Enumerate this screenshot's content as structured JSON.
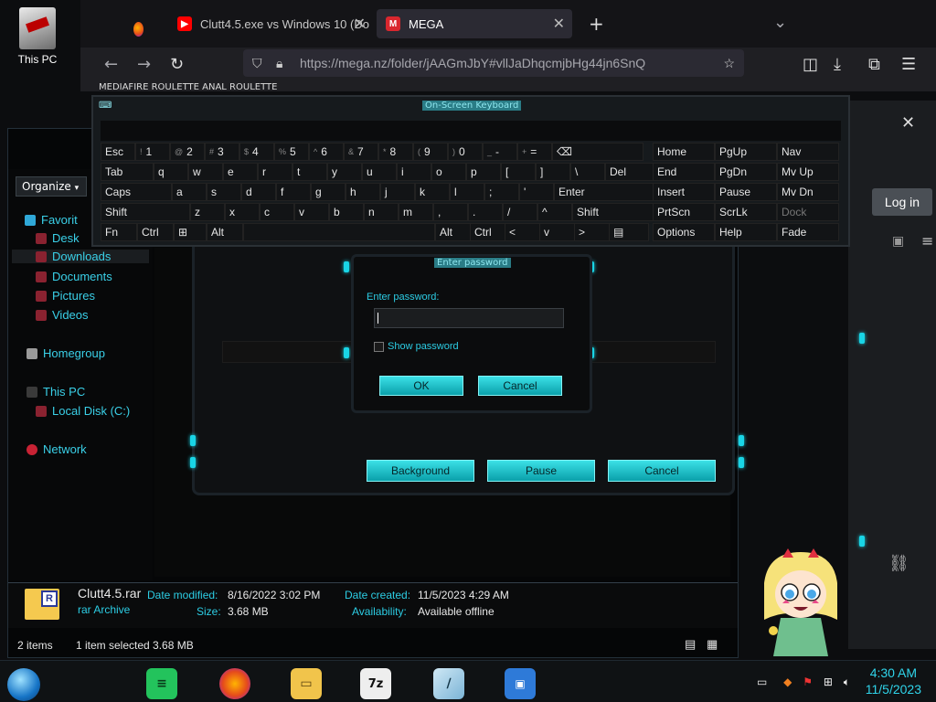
{
  "desktop": {
    "icon_label": "This PC"
  },
  "browser": {
    "tabs": [
      {
        "label": "Clutt4.5.exe vs Windows 10 (Do",
        "icon": "youtube-icon"
      },
      {
        "label": "MEGA",
        "icon": "mega-icon"
      }
    ],
    "url": "https://mega.nz/folder/jAAGmJbY#vllJaDhqcmjbHg44jn6SnQ",
    "bookmarks": "MEDIAFIRE ROULETTE     ANAL ROULETTE"
  },
  "explorer": {
    "organize": "Organize",
    "tree": {
      "favorites": "Favorit",
      "desktop": "Desk",
      "downloads": "Downloads",
      "documents": "Documents",
      "pictures": "Pictures",
      "videos": "Videos",
      "homegroup": "Homegroup",
      "this_pc": "This PC",
      "local_disk": "Local Disk (C:)",
      "network": "Network"
    },
    "details": {
      "file_name": "Clutt4.5.rar",
      "file_type": "rar Archive",
      "date_modified_label": "Date modified:",
      "date_modified": "8/16/2022 3:02 PM",
      "size_label": "Size:",
      "size": "3.68 MB",
      "date_created_label": "Date created:",
      "date_created": "11/5/2023 4:29 AM",
      "availability_label": "Availability:",
      "availability": "Available offline"
    },
    "status": {
      "items": "2 items",
      "selected": "1 item selected  3.68 MB"
    }
  },
  "mega": {
    "login": "Log in"
  },
  "progress_dialog": {
    "background": "Background",
    "pause": "Pause",
    "cancel": "Cancel"
  },
  "password_dialog": {
    "title": "Enter password",
    "label": "Enter password:",
    "value": "",
    "show_password": "Show password",
    "ok": "OK",
    "cancel": "Cancel"
  },
  "keyboard": {
    "title": "On-Screen Keyboard",
    "rows": {
      "r1": [
        "Esc",
        "1",
        "2",
        "3",
        "4",
        "5",
        "6",
        "7",
        "8",
        "9",
        "0",
        "-",
        "="
      ],
      "r1_sub": [
        "~ `",
        "!",
        "@",
        "#",
        "$",
        "%",
        "^",
        "&",
        "*",
        "(",
        ")",
        "_",
        "+"
      ],
      "r2": [
        "Tab",
        "q",
        "w",
        "e",
        "r",
        "t",
        "y",
        "u",
        "i",
        "o",
        "p",
        "[",
        "]",
        "\\",
        "Del"
      ],
      "r3": [
        "Caps",
        "a",
        "s",
        "d",
        "f",
        "g",
        "h",
        "j",
        "k",
        "l",
        ";",
        "'",
        "Enter"
      ],
      "r4": [
        "Shift",
        "z",
        "x",
        "c",
        "v",
        "b",
        "n",
        "m",
        ",",
        ".",
        "/",
        "^",
        "Shift"
      ],
      "r5": [
        "Fn",
        "Ctrl",
        "Alt",
        "Alt",
        "Ctrl",
        "<",
        "v",
        ">"
      ]
    },
    "right": {
      "c1": [
        "Home",
        "End",
        "Insert",
        "PrtScn",
        "Options"
      ],
      "c2": [
        "PgUp",
        "PgDn",
        "Pause",
        "ScrLk",
        "Help"
      ],
      "c3": [
        "Nav",
        "Mv Up",
        "Mv Dn",
        "Dock",
        "Fade"
      ]
    }
  },
  "taskbar": {
    "time": "4:30 AM",
    "date": "11/5/2023"
  }
}
